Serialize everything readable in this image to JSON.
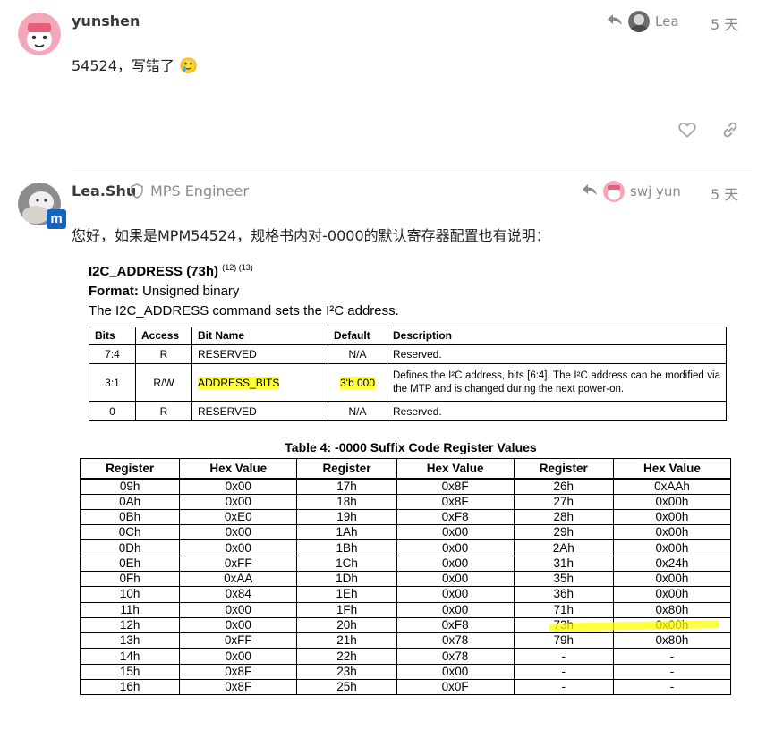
{
  "posts": [
    {
      "username": "yunshen",
      "reply_to": "Lea",
      "date": "5 天",
      "body": "54524，写错了",
      "emoji": "🥲"
    },
    {
      "username": "Lea.Shu",
      "user_title": "MPS Engineer",
      "reply_to": "swj yun",
      "date": "5 天",
      "body": "您好，如果是MPM54524，规格书内对-0000的默认寄存器配置也有说明：",
      "image": {
        "title": "I2C_ADDRESS (73h)",
        "title_notes": "(12) (13)",
        "format_label": "Format:",
        "format_value": "Unsigned binary",
        "description": "The I2C_ADDRESS command sets the I²C address.",
        "bit_table": {
          "headers": [
            "Bits",
            "Access",
            "Bit Name",
            "Default",
            "Description"
          ],
          "rows": [
            [
              "7:4",
              "R",
              "RESERVED",
              "N/A",
              "Reserved."
            ],
            [
              "3:1",
              "R/W",
              "ADDRESS_BITS",
              "3'b 000",
              "Defines the I²C address, bits [6:4]. The I²C address can be modified via the MTP and is changed during the next power-on."
            ],
            [
              "0",
              "R",
              "RESERVED",
              "N/A",
              "Reserved."
            ]
          ]
        },
        "table4_caption": "Table 4: -0000 Suffix Code Register Values",
        "reg_table": {
          "headers": [
            "Register",
            "Hex Value",
            "Register",
            "Hex Value",
            "Register",
            "Hex Value"
          ],
          "rows": [
            [
              "09h",
              "0x00",
              "17h",
              "0x8F",
              "26h",
              "0xAAh"
            ],
            [
              "0Ah",
              "0x00",
              "18h",
              "0x8F",
              "27h",
              "0x00h"
            ],
            [
              "0Bh",
              "0xE0",
              "19h",
              "0xF8",
              "28h",
              "0x00h"
            ],
            [
              "0Ch",
              "0x00",
              "1Ah",
              "0x00",
              "29h",
              "0x00h"
            ],
            [
              "0Dh",
              "0x00",
              "1Bh",
              "0x00",
              "2Ah",
              "0x00h"
            ],
            [
              "0Eh",
              "0xFF",
              "1Ch",
              "0x00",
              "31h",
              "0x24h"
            ],
            [
              "0Fh",
              "0xAA",
              "1Dh",
              "0x00",
              "35h",
              "0x00h"
            ],
            [
              "10h",
              "0x84",
              "1Eh",
              "0x00",
              "36h",
              "0x00h"
            ],
            [
              "11h",
              "0x00",
              "1Fh",
              "0x00",
              "71h",
              "0x80h"
            ],
            [
              "12h",
              "0x00",
              "20h",
              "0xF8",
              "73h",
              "0x00h"
            ],
            [
              "13h",
              "0xFF",
              "21h",
              "0x78",
              "79h",
              "0x80h"
            ],
            [
              "14h",
              "0x00",
              "22h",
              "0x78",
              "-",
              "-"
            ],
            [
              "15h",
              "0x8F",
              "23h",
              "0x00",
              "-",
              "-"
            ],
            [
              "16h",
              "0x8F",
              "25h",
              "0x0F",
              "-",
              "-"
            ]
          ]
        }
      }
    }
  ],
  "icons": {
    "reply": "reply-arrow-icon",
    "like": "heart-icon",
    "share": "link-icon",
    "moderator": "shield-icon"
  },
  "colors": {
    "muted": "#8a8a8a",
    "highlight": "#ffff00",
    "avatar_pink": "#f4a7b9",
    "badge_blue": "#1565c0"
  }
}
